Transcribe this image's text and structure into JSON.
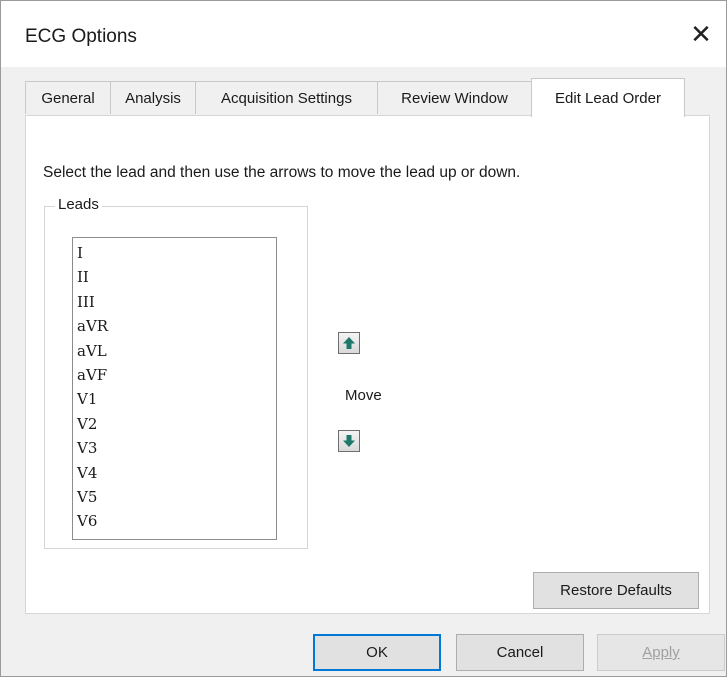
{
  "window": {
    "title": "ECG Options",
    "close_symbol": "✕"
  },
  "tabs": [
    {
      "label": "General",
      "active": false
    },
    {
      "label": "Analysis",
      "active": false
    },
    {
      "label": "Acquisition Settings",
      "active": false
    },
    {
      "label": "Review Window",
      "active": false
    },
    {
      "label": "Edit Lead Order",
      "active": true
    }
  ],
  "panel": {
    "instruction": "Select the lead and then use the arrows to move the lead up or down.",
    "leads_group_label": "Leads",
    "leads": [
      "I",
      "II",
      "III",
      "aVR",
      "aVL",
      "aVF",
      "V1",
      "V2",
      "V3",
      "V4",
      "V5",
      "V6"
    ],
    "move_label": "Move",
    "up_icon": "arrow-up-icon",
    "down_icon": "arrow-down-icon",
    "restore_defaults_label": "Restore Defaults"
  },
  "buttons": {
    "ok": "OK",
    "cancel": "Cancel",
    "apply": "Apply",
    "apply_enabled": false
  },
  "colors": {
    "accent": "#0078d7",
    "arrow_fill": "#1d7a6b"
  }
}
